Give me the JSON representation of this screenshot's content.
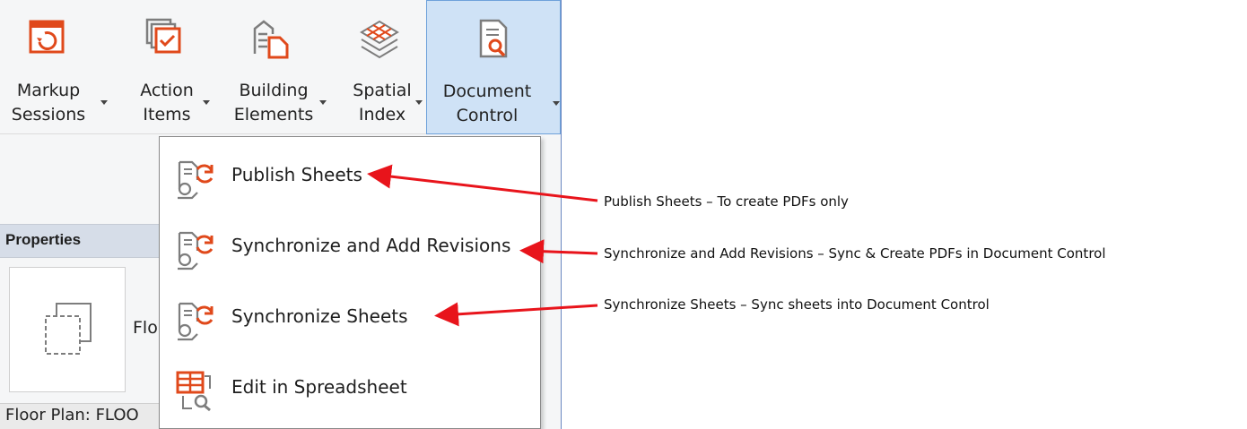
{
  "ribbon": {
    "buttons": [
      {
        "line1": "Markup",
        "line2": "Sessions",
        "icon": "markup-sessions-icon"
      },
      {
        "line1": "Action",
        "line2": "Items",
        "icon": "action-items-icon"
      },
      {
        "line1": "Building",
        "line2": "Elements",
        "icon": "building-elements-icon"
      },
      {
        "line1": "Spatial",
        "line2": "Index",
        "icon": "spatial-index-icon"
      },
      {
        "line1": "Document",
        "line2": "Control",
        "icon": "document-control-icon"
      }
    ]
  },
  "properties": {
    "title": "Properties",
    "type_label": "Flo",
    "footer": "Floor Plan: FLOO"
  },
  "menu": {
    "items": [
      {
        "label": "Publish Sheets",
        "icon": "publish-sheets-icon"
      },
      {
        "label": "Synchronize and Add Revisions",
        "icon": "synchronize-revisions-icon"
      },
      {
        "label": "Synchronize Sheets",
        "icon": "synchronize-sheets-icon"
      },
      {
        "label": "Edit in Spreadsheet",
        "icon": "spreadsheet-icon"
      }
    ]
  },
  "annotations": [
    {
      "text": "Publish Sheets – To create PDFs only"
    },
    {
      "text": "Synchronize and Add Revisions – Sync & Create PDFs in Document Control"
    },
    {
      "text": "Synchronize Sheets – Sync sheets into Document Control"
    }
  ],
  "colors": {
    "accent_orange": "#e0491b",
    "icon_gray": "#7d7d7d",
    "active_button_bg": "#cfe2f6",
    "arrow_red": "#e8141b"
  }
}
